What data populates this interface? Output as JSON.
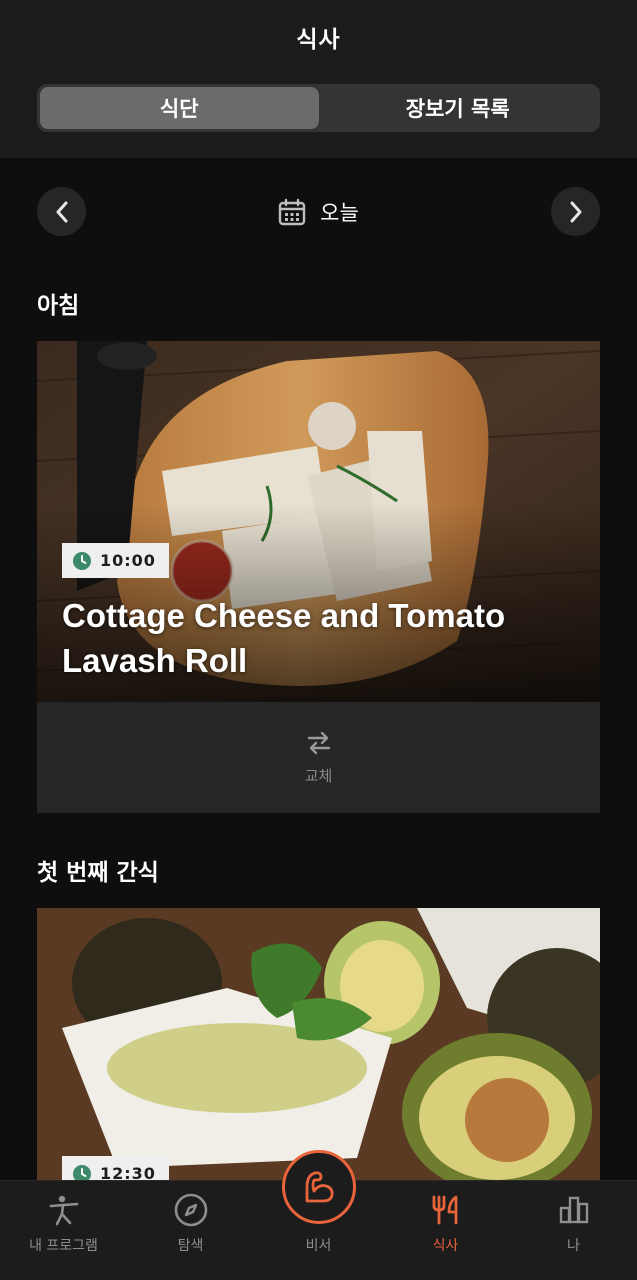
{
  "header": {
    "title": "식사",
    "segments": [
      {
        "label": "식단",
        "active": true
      },
      {
        "label": "장보기 목록",
        "active": false
      }
    ]
  },
  "date_nav": {
    "label": "오늘",
    "icons": {
      "prev": "chevron-left-icon",
      "calendar": "calendar-icon",
      "next": "chevron-right-icon"
    }
  },
  "meals": [
    {
      "section": "아침",
      "time": "10:00",
      "name": "Cottage Cheese and Tomato Lavash Roll",
      "replace_label": "교체"
    },
    {
      "section": "첫 번째 간식",
      "time": "12:30"
    }
  ],
  "tabbar": {
    "items": [
      {
        "label": "내 프로그램",
        "icon": "stretching-person-icon",
        "active": false
      },
      {
        "label": "탐색",
        "icon": "compass-icon",
        "active": false
      },
      {
        "label": "비서",
        "icon": "flexed-arm-icon",
        "active": false
      },
      {
        "label": "식사",
        "icon": "fork-knife-icon",
        "active": true
      },
      {
        "label": "나",
        "icon": "bar-chart-icon",
        "active": false
      }
    ]
  },
  "colors": {
    "accent": "#e8643a",
    "background": "#0e0e0e",
    "surface": "#1c1c1d",
    "clock_green": "#3d8a6a"
  }
}
